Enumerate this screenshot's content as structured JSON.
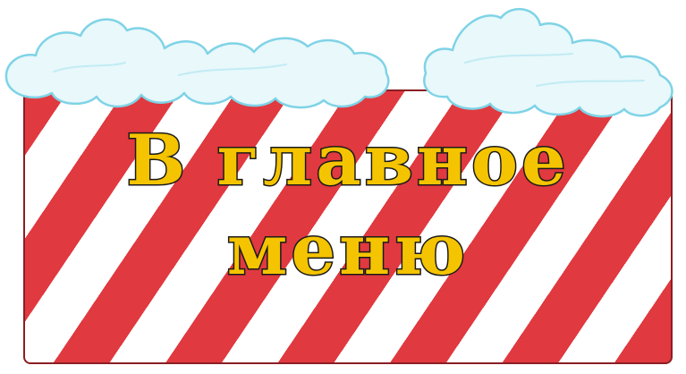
{
  "button": {
    "line1": "В главное",
    "line2": "меню"
  },
  "colors": {
    "stripe_red": "#e0393f",
    "stripe_white": "#ffffff",
    "text_fill": "#f5c400",
    "text_outline": "#1a1a1a",
    "cloud_fill": "#e8f8fb",
    "cloud_outline": "#7fd3e6"
  },
  "icons": {
    "decoration": "snow-cloud-icon"
  }
}
